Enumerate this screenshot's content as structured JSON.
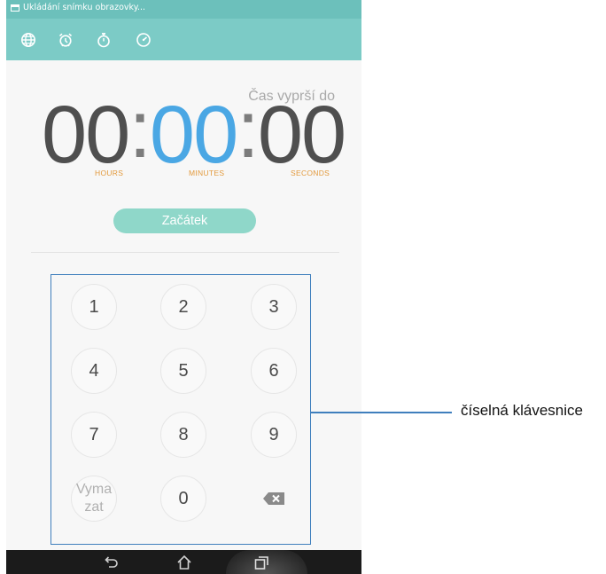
{
  "status_bar": {
    "notification": "Ukládání snímku obrazovky..."
  },
  "toolbar": {
    "tabs": [
      {
        "icon": "globe-icon"
      },
      {
        "icon": "alarm-clock-icon"
      },
      {
        "icon": "stopwatch-icon"
      },
      {
        "icon": "timer-icon"
      }
    ]
  },
  "timer": {
    "expire_label": "Čas vyprší do",
    "hours": "00",
    "minutes": "00",
    "seconds": "00",
    "separator": ":",
    "hours_label": "HOURS",
    "minutes_label": "MINUTES",
    "seconds_label": "SECONDS",
    "start_label": "Začátek"
  },
  "keypad": {
    "keys": [
      "1",
      "2",
      "3",
      "4",
      "5",
      "6",
      "7",
      "8",
      "9"
    ],
    "clear_line1": "Vyma",
    "clear_line2": "zat",
    "zero": "0",
    "backspace_icon": "backspace-icon"
  },
  "nav": {
    "buttons": [
      "back-icon",
      "home-icon",
      "recent-apps-icon"
    ]
  },
  "callout": {
    "label": "číselná klávesnice"
  },
  "colors": {
    "toolbar": "#7ccbc6",
    "minutes": "#4aa7e4",
    "units": "#e39a3d",
    "start_button": "#8fd7c9",
    "callout": "#3f7fbd"
  }
}
